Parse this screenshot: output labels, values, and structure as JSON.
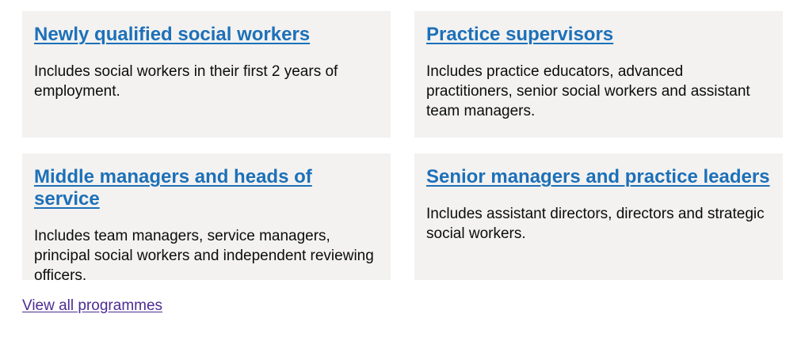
{
  "cards": [
    {
      "title": "Newly qualified social workers",
      "description": "Includes social workers in their first 2 years of employment."
    },
    {
      "title": "Practice supervisors",
      "description": "Includes practice educators, advanced practitioners, senior social workers and assistant team managers."
    },
    {
      "title": "Middle managers and heads of service",
      "description": "Includes team managers, service managers, principal social workers and independent reviewing officers."
    },
    {
      "title": "Senior managers and practice leaders",
      "description": "Includes assistant directors, directors and strategic social workers."
    }
  ],
  "view_all_label": "View all programmes",
  "colors": {
    "link": "#1d70b8",
    "visited_link": "#4c2c92",
    "card_background": "#f3f2f1",
    "text": "#0b0c0c"
  }
}
